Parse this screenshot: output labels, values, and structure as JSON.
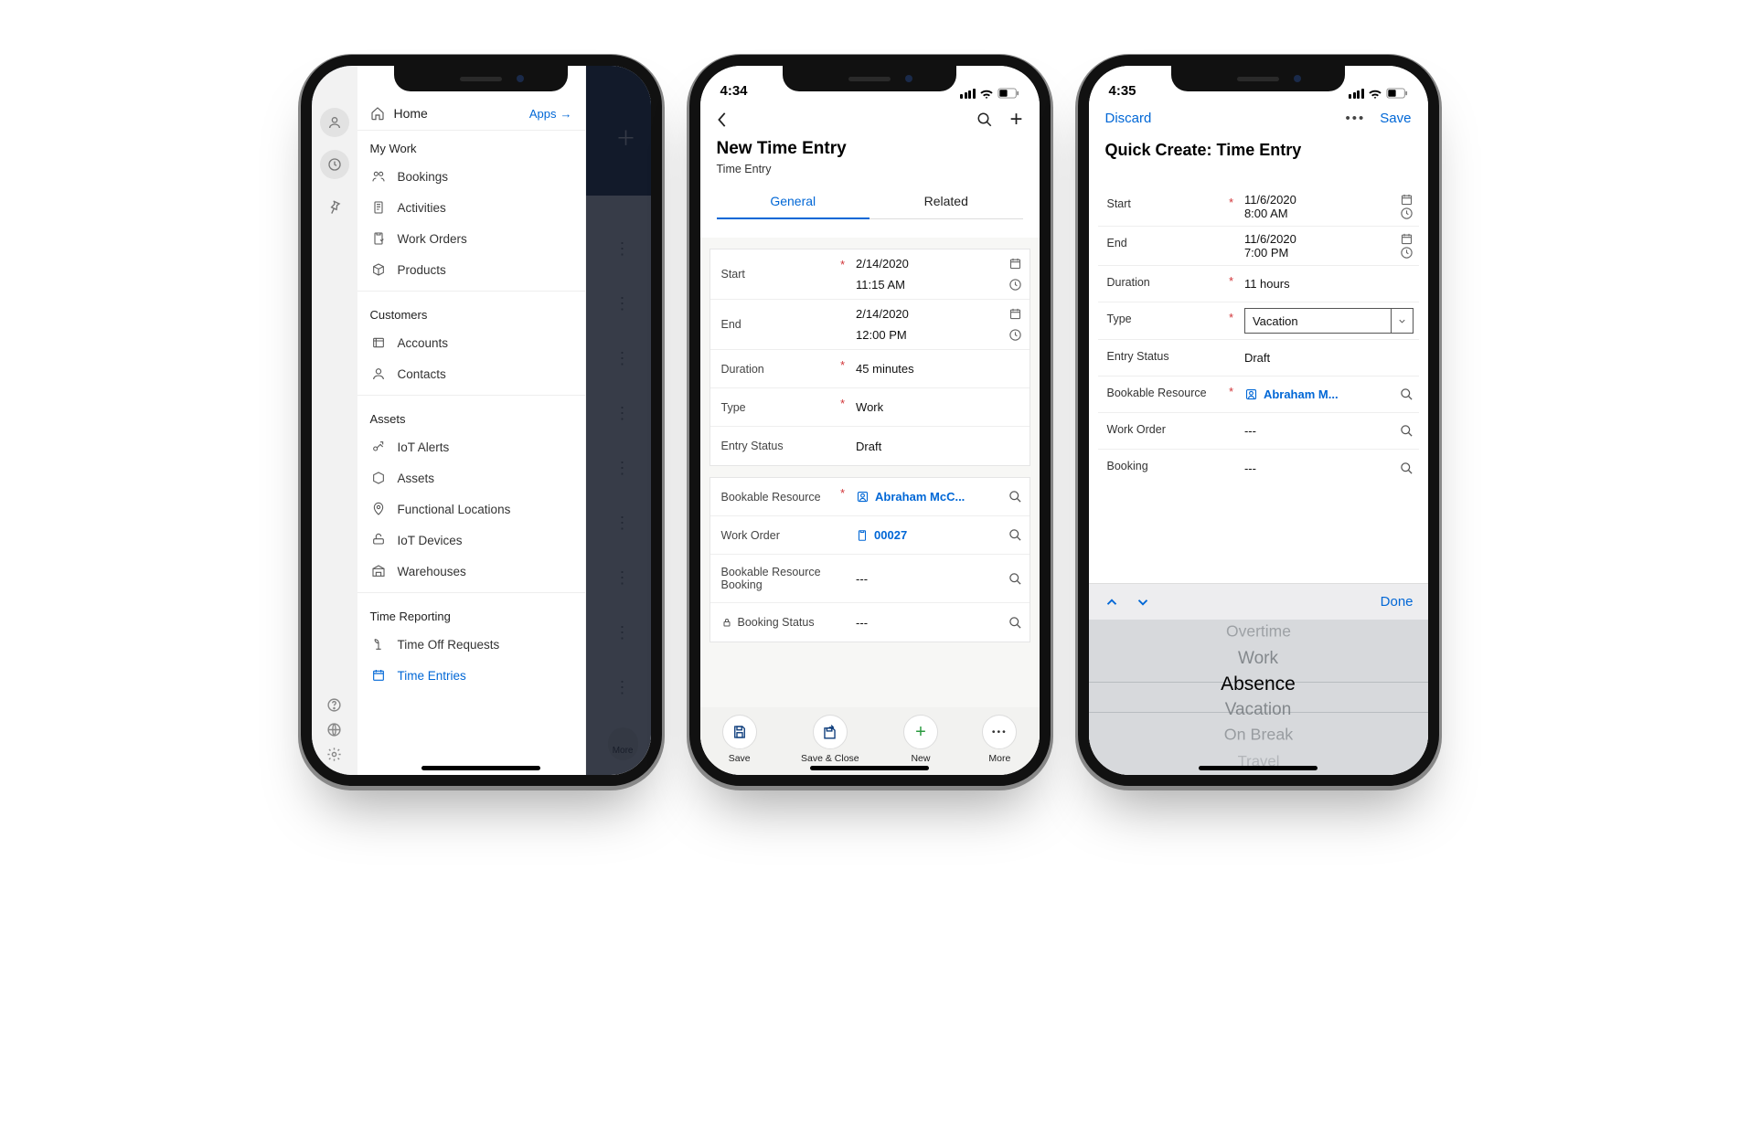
{
  "phone1": {
    "nav": {
      "home_label": "Home",
      "apps_label": "Apps",
      "sections": {
        "mywork": {
          "title": "My Work",
          "items": [
            {
              "label": "Bookings"
            },
            {
              "label": "Activities"
            },
            {
              "label": "Work Orders"
            },
            {
              "label": "Products"
            }
          ]
        },
        "customers": {
          "title": "Customers",
          "items": [
            {
              "label": "Accounts"
            },
            {
              "label": "Contacts"
            }
          ]
        },
        "assets": {
          "title": "Assets",
          "items": [
            {
              "label": "IoT Alerts"
            },
            {
              "label": "Assets"
            },
            {
              "label": "Functional Locations"
            },
            {
              "label": "IoT Devices"
            },
            {
              "label": "Warehouses"
            }
          ]
        },
        "timereporting": {
          "title": "Time Reporting",
          "items": [
            {
              "label": "Time Off Requests"
            },
            {
              "label": "Time Entries"
            }
          ]
        }
      }
    },
    "behind_more": "More"
  },
  "phone2": {
    "status_time": "4:34",
    "title": "New Time Entry",
    "subtitle": "Time Entry",
    "tabs": {
      "general": "General",
      "related": "Related"
    },
    "fields": {
      "start": {
        "label": "Start",
        "date": "2/14/2020",
        "time": "11:15 AM"
      },
      "end": {
        "label": "End",
        "date": "2/14/2020",
        "time": "12:00 PM"
      },
      "duration": {
        "label": "Duration",
        "value": "45 minutes"
      },
      "type": {
        "label": "Type",
        "value": "Work"
      },
      "entry_status": {
        "label": "Entry Status",
        "value": "Draft"
      },
      "bookable_resource": {
        "label": "Bookable Resource",
        "value": "Abraham McC..."
      },
      "work_order": {
        "label": "Work Order",
        "value": "00027"
      },
      "brb": {
        "label": "Bookable Resource Booking",
        "value": "---"
      },
      "booking_status": {
        "label": "Booking Status",
        "value": "---"
      }
    },
    "actions": {
      "save": "Save",
      "save_close": "Save & Close",
      "new": "New",
      "more": "More"
    }
  },
  "phone3": {
    "status_time": "4:35",
    "discard": "Discard",
    "save": "Save",
    "title": "Quick Create: Time Entry",
    "fields": {
      "start": {
        "label": "Start",
        "date": "11/6/2020",
        "time": "8:00 AM"
      },
      "end": {
        "label": "End",
        "date": "11/6/2020",
        "time": "7:00 PM"
      },
      "duration": {
        "label": "Duration",
        "value": "11 hours"
      },
      "type": {
        "label": "Type",
        "value": "Vacation"
      },
      "entry_status": {
        "label": "Entry Status",
        "value": "Draft"
      },
      "bookable_resource": {
        "label": "Bookable Resource",
        "value": "Abraham M..."
      },
      "work_order": {
        "label": "Work Order",
        "value": "---"
      },
      "booking": {
        "label": "Booking",
        "value": "---"
      }
    },
    "picker_done": "Done",
    "picker_options": [
      "Overtime",
      "Work",
      "Absence",
      "Vacation",
      "On Break",
      "Travel"
    ]
  }
}
